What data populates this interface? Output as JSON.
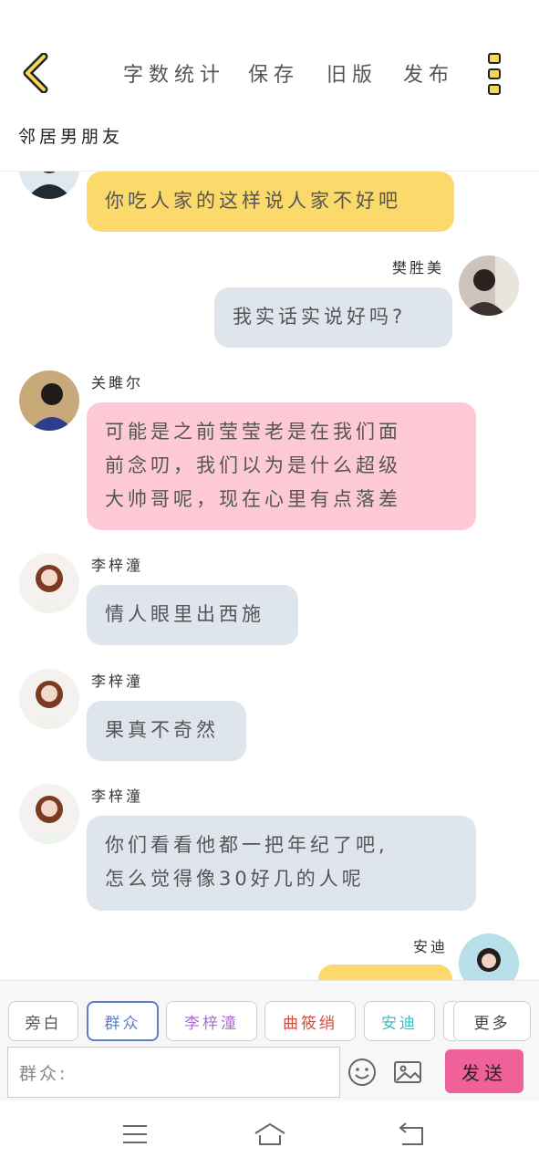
{
  "header": {
    "back_icon": "chevron-left-icon",
    "word_count_label": "字数统计",
    "save_label": "保存",
    "old_version_label": "旧版",
    "publish_label": "发布",
    "more_icon": "more-vertical-icon",
    "title": "邻居男朋友"
  },
  "messages": [
    {
      "speaker": "",
      "text": "你吃人家的这样说人家不好吧",
      "side": "left",
      "color": "#fbd96a"
    },
    {
      "speaker": "樊胜美",
      "text": "我实话实说好吗?",
      "side": "right",
      "color": "#dfe5ed"
    },
    {
      "speaker": "关雎尔",
      "lines": [
        "可能是之前莹莹老是在我们面",
        "前念叨，我们以为是什么超级",
        "大帅哥呢，现在心里有点落差"
      ],
      "side": "left",
      "color": "#fdc9d5"
    },
    {
      "speaker": "李梓潼",
      "text": "情人眼里出西施",
      "side": "left",
      "color": "#dfe5ed"
    },
    {
      "speaker": "李梓潼",
      "text": "果真不奇然",
      "side": "left",
      "color": "#dfe5ed"
    },
    {
      "speaker": "李梓潼",
      "lines": [
        "你们看看他都一把年纪了吧,",
        "怎么觉得像30好几的人呢"
      ],
      "side": "left",
      "color": "#dfe5ed"
    },
    {
      "speaker": "安迪",
      "text": "",
      "side": "right",
      "color": "#fbd96a"
    }
  ],
  "roles": [
    {
      "label": "旁白",
      "color": "#555555"
    },
    {
      "label": "群众",
      "color": "#5b7fc7"
    },
    {
      "label": "李梓潼",
      "color": "#b06ad0"
    },
    {
      "label": "曲筱绡",
      "color": "#d24a3a"
    },
    {
      "label": "安迪",
      "color": "#3bbfbf"
    }
  ],
  "more_roles_label": "更多",
  "input": {
    "value": "群众:"
  },
  "emoji_icon": "emoji-icon",
  "image_icon": "image-icon",
  "send_label": "发送",
  "navbar": {
    "menu_icon": "menu-icon",
    "home_icon": "home-icon",
    "back_icon": "back-icon"
  }
}
